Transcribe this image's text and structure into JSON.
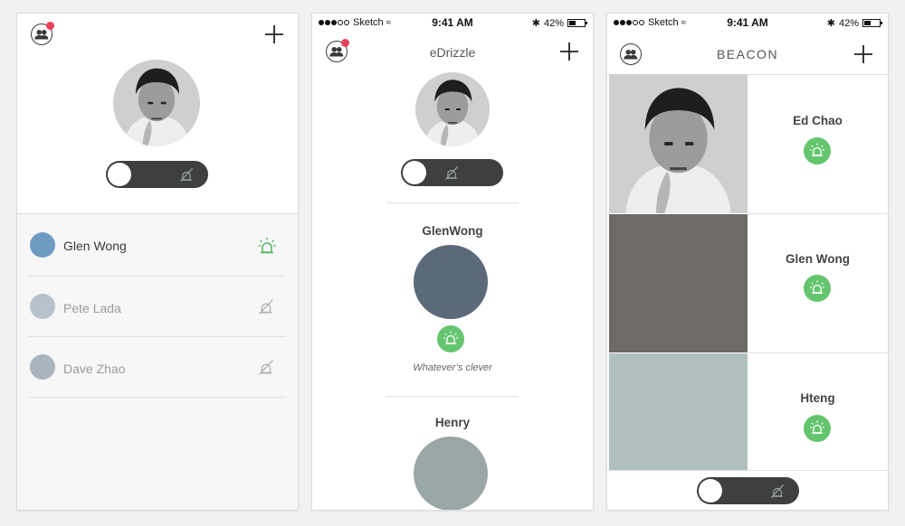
{
  "status_bar": {
    "carrier": "Sketch",
    "time": "9:41 AM",
    "battery": "42%"
  },
  "screen1": {
    "contacts": [
      {
        "name": "Glen Wong",
        "active": true
      },
      {
        "name": "Pete Lada",
        "active": false
      },
      {
        "name": "Dave Zhao",
        "active": false
      }
    ]
  },
  "screen2": {
    "title": "eDrizzle",
    "feed": [
      {
        "name": "GlenWong",
        "caption": "Whatever’s clever"
      },
      {
        "name": "Henry"
      }
    ]
  },
  "screen3": {
    "title": "BEACON",
    "cards": [
      {
        "name": "Ed Chao"
      },
      {
        "name": "Glen Wong"
      },
      {
        "name": "Hteng"
      }
    ]
  },
  "colors": {
    "accent_green": "#65c56f",
    "notification_red": "#e8425a",
    "toggle_dark": "#3d3f40"
  },
  "icons": [
    "people-icon",
    "plus-icon",
    "beacon-alarm-icon",
    "beacon-off-icon"
  ]
}
